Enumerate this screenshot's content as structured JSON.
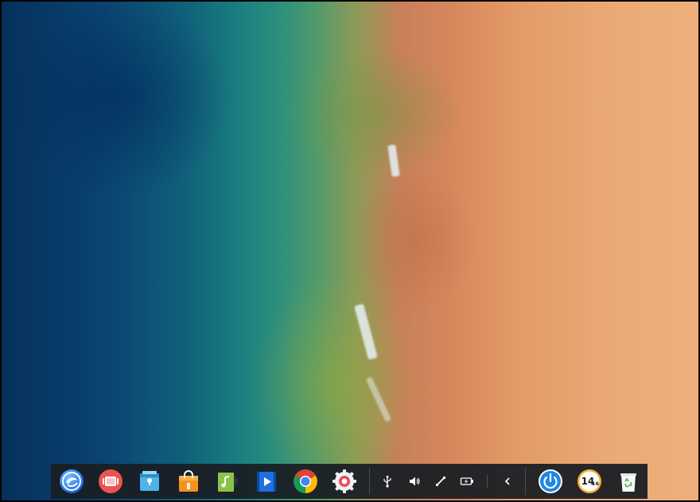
{
  "desktop": {
    "wallpaper": "aerial-beach-ocean"
  },
  "dock": {
    "background": "#1a1e24",
    "apps": [
      {
        "name": "launcher",
        "icon": "deepin-launcher-icon",
        "color": "#1a73e8"
      },
      {
        "name": "multitasking-view",
        "icon": "multitask-view-icon",
        "color": "#f05a4a"
      },
      {
        "name": "file-manager",
        "icon": "file-manager-icon",
        "color": "#4db3e8"
      },
      {
        "name": "app-store",
        "icon": "store-bag-icon",
        "color": "#f28a1e"
      },
      {
        "name": "music",
        "icon": "music-icon",
        "color": "#8bc34a"
      },
      {
        "name": "movie",
        "icon": "movie-icon",
        "color": "#1e6fe0"
      },
      {
        "name": "chrome",
        "icon": "chrome-icon",
        "color": "#db4437"
      },
      {
        "name": "control-center",
        "icon": "settings-gear-icon",
        "color": "#e84b5b"
      }
    ],
    "tray": [
      {
        "name": "usb",
        "icon": "usb-icon"
      },
      {
        "name": "sound",
        "icon": "volume-icon"
      },
      {
        "name": "network",
        "icon": "network-icon"
      },
      {
        "name": "battery",
        "icon": "battery-charging-icon"
      },
      {
        "name": "expand",
        "icon": "chevron-left-icon"
      }
    ],
    "shutdown": {
      "icon": "power-icon",
      "color": "#1e88e5"
    },
    "clock": {
      "hour": "14",
      "minute": "16"
    },
    "trash": {
      "icon": "trash-icon",
      "color": "#4caf50"
    }
  }
}
